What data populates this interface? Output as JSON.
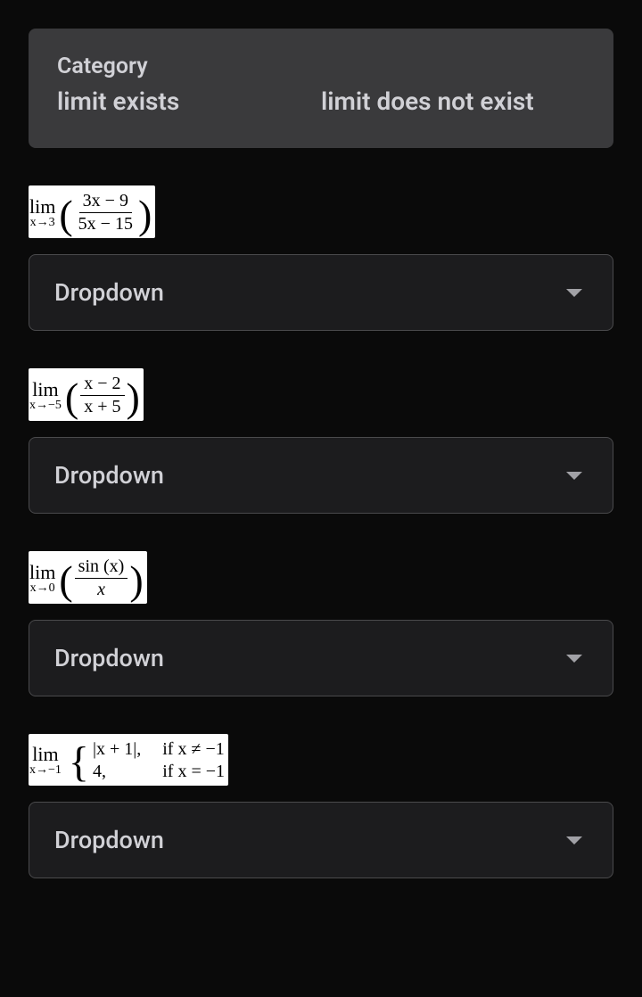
{
  "header": {
    "category_label": "Category",
    "col1": "limit exists",
    "col2": "limit does not exist"
  },
  "dropdown_label": "Dropdown",
  "items": [
    {
      "lim_top": "lim",
      "lim_bottom": "x→3",
      "numerator": "3x − 9",
      "denominator": "5x − 15"
    },
    {
      "lim_top": "lim",
      "lim_bottom": "x→−5",
      "numerator": "x − 2",
      "denominator": "x + 5"
    },
    {
      "lim_top": "lim",
      "lim_bottom": "x→0",
      "numerator": "sin (x)",
      "denominator": "x"
    },
    {
      "lim_top": "lim",
      "lim_bottom": "x→−1",
      "row1_left": "|x + 1|,",
      "row1_right": "if x ≠ −1",
      "row2_left": "4,",
      "row2_right": "if x = −1"
    }
  ]
}
